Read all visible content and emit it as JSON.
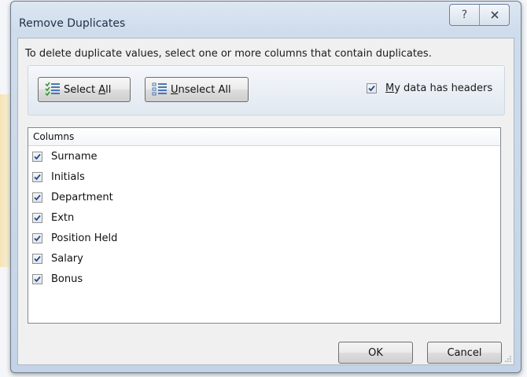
{
  "dialog": {
    "title": "Remove Duplicates",
    "help_button": "?",
    "close_button": "✕",
    "instruction": "To delete duplicate values, select one or more columns that contain duplicates.",
    "select_all": {
      "accel": "Select ",
      "underlined": "A",
      "rest": "ll"
    },
    "unselect_all": {
      "underlined": "U",
      "rest": "nselect All"
    },
    "headers_checkbox": {
      "underlined": "M",
      "rest": "y data has headers",
      "checked": true
    },
    "columns_header": "Columns",
    "columns": [
      {
        "label": "Surname",
        "checked": true
      },
      {
        "label": "Initials",
        "checked": true
      },
      {
        "label": "Department",
        "checked": true
      },
      {
        "label": "Extn",
        "checked": true
      },
      {
        "label": "Position Held",
        "checked": true
      },
      {
        "label": "Salary",
        "checked": true
      },
      {
        "label": "Bonus",
        "checked": true
      }
    ],
    "ok_label": "OK",
    "cancel_label": "Cancel"
  },
  "colors": {
    "check_mark": "#2b4a8a",
    "title_text": "#1e3046"
  },
  "icons": {
    "select_all_icon": "green-checklist-icon",
    "unselect_all_icon": "blue-list-icon",
    "help_icon": "question-mark-icon",
    "close_icon": "close-icon"
  }
}
